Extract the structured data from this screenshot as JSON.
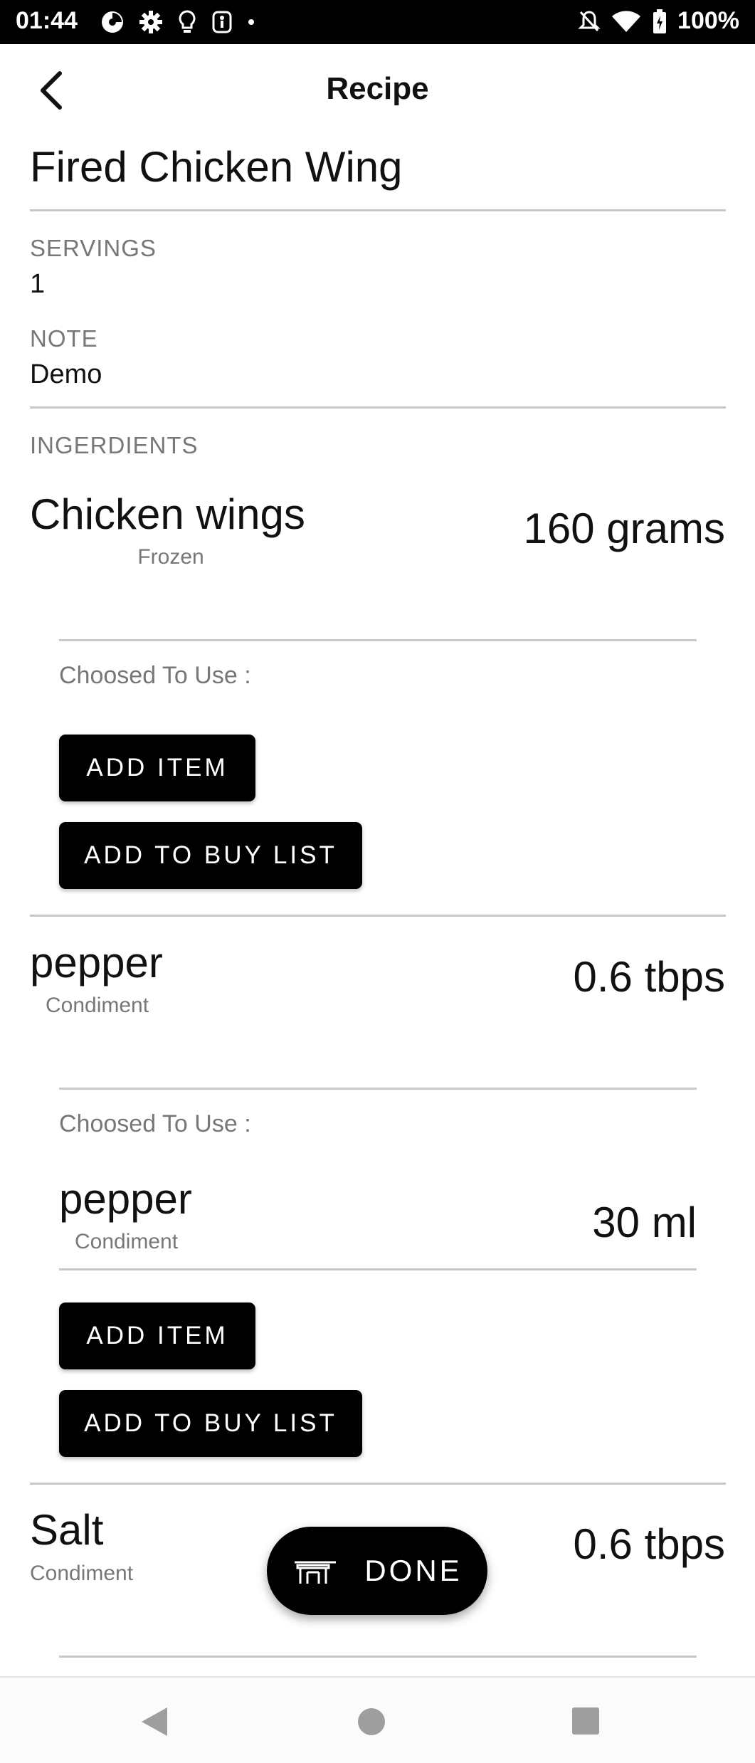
{
  "status_bar": {
    "time": "01:44",
    "battery": "100%",
    "icons_left": [
      "data-saver-icon",
      "settings-icon",
      "bulb-icon",
      "accessibility-icon",
      "dot-icon"
    ],
    "icons_right": [
      "notifications-off-icon",
      "wifi-icon",
      "battery-icon"
    ]
  },
  "app_bar": {
    "title": "Recipe",
    "back_icon": "back-arrow-icon"
  },
  "recipe": {
    "name": "Fired Chicken Wing",
    "servings_label": "SERVINGS",
    "servings_value": "1",
    "note_label": "NOTE",
    "note_value": "Demo",
    "ingredients_label": "INGERDIENTS"
  },
  "ingredients": [
    {
      "name": "Chicken wings",
      "category": "Frozen",
      "quantity": "160 grams",
      "chosen_label": "Choosed To Use :",
      "chosen_items": [],
      "add_item_label": "ADD ITEM",
      "add_buy_label": "ADD TO BUY LIST"
    },
    {
      "name": "pepper",
      "category": "Condiment",
      "quantity": "0.6 tbps",
      "chosen_label": "Choosed To Use :",
      "chosen_items": [
        {
          "name": "pepper",
          "category": "Condiment",
          "quantity": "30 ml"
        }
      ],
      "add_item_label": "ADD ITEM",
      "add_buy_label": "ADD TO BUY LIST"
    },
    {
      "name": "Salt",
      "category": "Condiment",
      "quantity": "0.6 tbps"
    }
  ],
  "fab": {
    "label": "DONE",
    "icon": "cooking-pot-icon"
  },
  "nav_bar": {
    "icons": [
      "nav-back-icon",
      "nav-home-icon",
      "nav-recents-icon"
    ]
  }
}
